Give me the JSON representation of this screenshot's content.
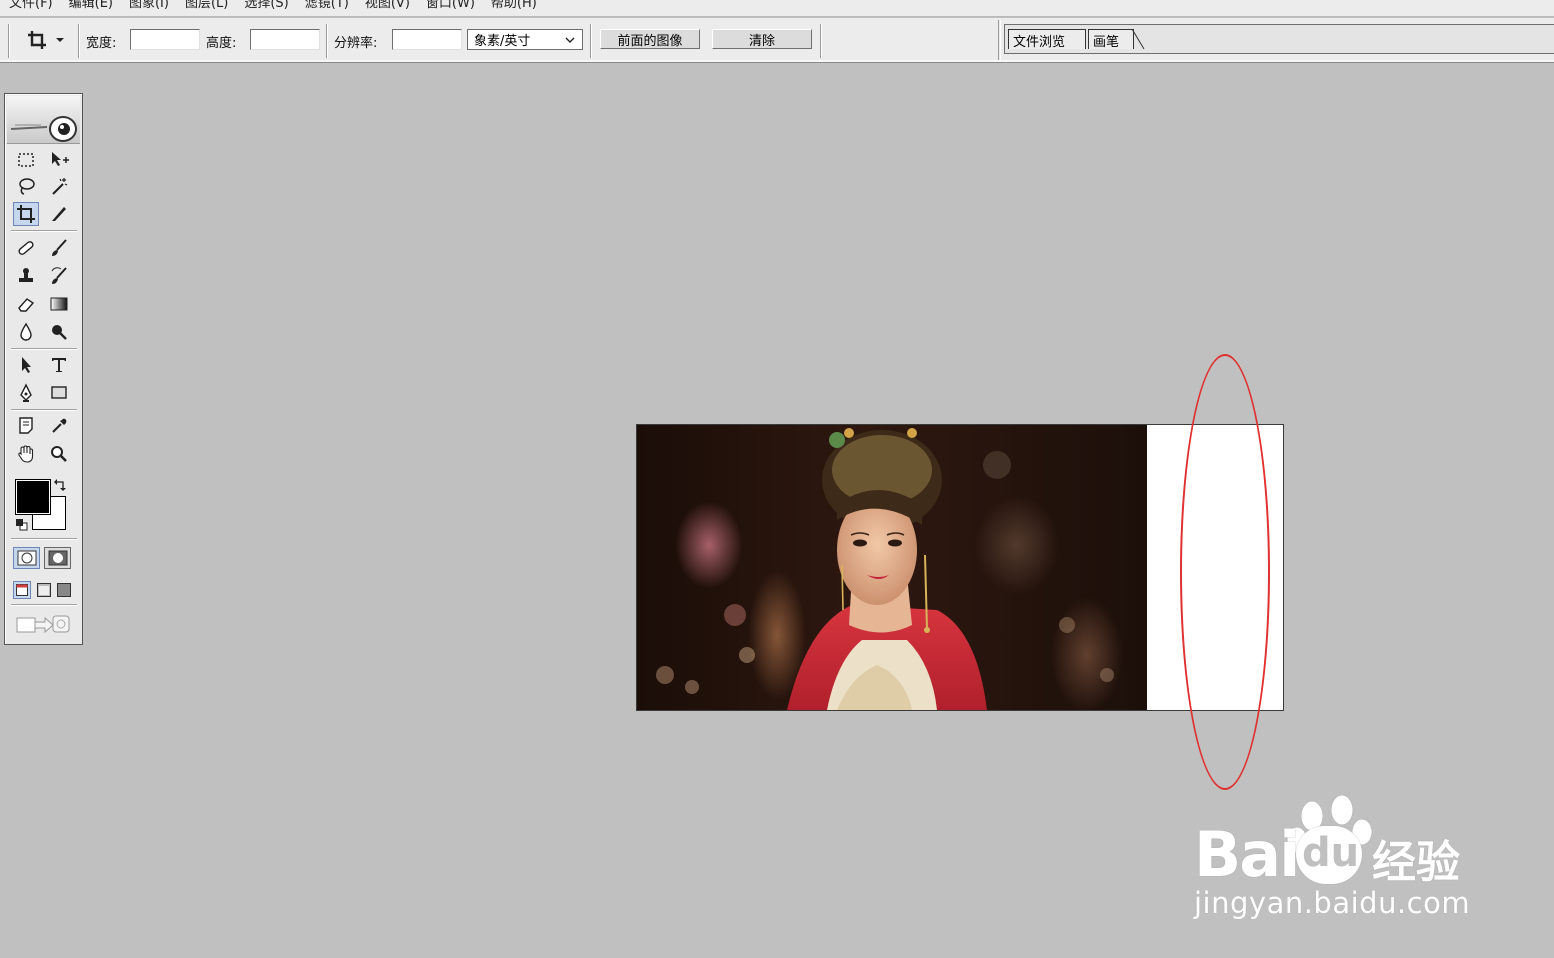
{
  "menu": [
    "文件(F)",
    "编辑(E)",
    "图象(I)",
    "图层(L)",
    "选择(S)",
    "滤镜(T)",
    "视图(V)",
    "窗口(W)",
    "帮助(H)"
  ],
  "options": {
    "width_label": "宽度:",
    "height_label": "高度:",
    "resolution_label": "分辨率:",
    "width_value": "",
    "height_value": "",
    "resolution_value": "",
    "unit_select": "象素/英寸",
    "front_image_button": "前面的图像",
    "clear_button": "清除"
  },
  "palette_well": {
    "tabs": [
      "文件浏览",
      "画笔"
    ]
  },
  "colors": {
    "foreground": "#000000",
    "background": "#ffffff",
    "annotation": "#e03030"
  },
  "watermark": {
    "brand": "Bai",
    "brand_cn": "经验",
    "url": "jingyan.baidu.com"
  }
}
